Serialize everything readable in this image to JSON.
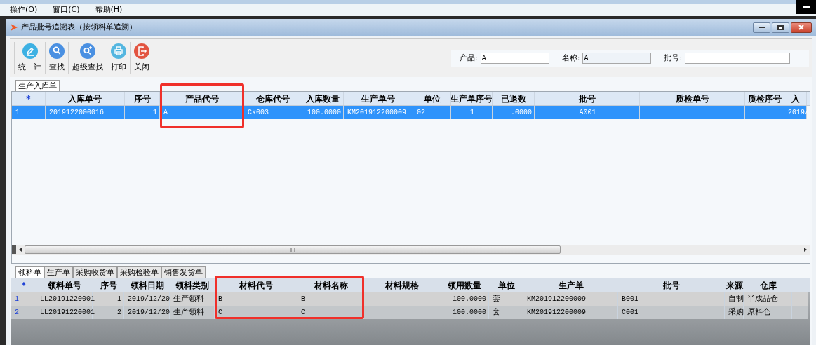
{
  "menu": [
    {
      "label": "操作(O)"
    },
    {
      "label": "窗口(C)"
    },
    {
      "label": "帮助(H)"
    }
  ],
  "window": {
    "title": "产品批号追溯表（按领料单追溯）"
  },
  "toolbar": [
    {
      "label": "统　计"
    },
    {
      "label": "查找"
    },
    {
      "label": "超级查找"
    },
    {
      "label": "打印"
    },
    {
      "label": "关闭"
    }
  ],
  "filters": [
    {
      "label": "产品:",
      "value": "A",
      "readonly": false
    },
    {
      "label": "名称:",
      "value": "A",
      "readonly": true
    },
    {
      "label": "批号:",
      "readonly": false
    }
  ],
  "top_tabs": [
    {
      "label": "生产入库单",
      "selected": true
    }
  ],
  "top_table": {
    "columns": [
      {
        "label": "*"
      },
      {
        "label": "入库单号"
      },
      {
        "label": "序号"
      },
      {
        "label": "产品代号",
        "highlighted": true
      },
      {
        "label": "仓库代号"
      },
      {
        "label": "入库数量"
      },
      {
        "label": "生产单号"
      },
      {
        "label": "单位"
      },
      {
        "label": "生产单序号"
      },
      {
        "label": "已退数"
      },
      {
        "label": "批号"
      },
      {
        "label": "质检单号"
      },
      {
        "label": "质检序号"
      },
      {
        "label": "入"
      }
    ],
    "rows": [
      {
        "selected": true,
        "cells": [
          "1",
          "2019122000016",
          "1",
          "A",
          "Ck003",
          "100.0000",
          "KM201912200009",
          "02",
          "1",
          ".0000",
          "A001",
          null,
          null,
          "2019/"
        ]
      }
    ]
  },
  "bottom_tabs": [
    {
      "label": "领料单",
      "selected": true
    },
    {
      "label": "生产单",
      "selected": false
    },
    {
      "label": "采购收货单",
      "selected": false
    },
    {
      "label": "采购检验单",
      "selected": false
    },
    {
      "label": "销售发货单",
      "selected": false
    }
  ],
  "bottom_table": {
    "columns": [
      {
        "label": "*"
      },
      {
        "label": "领料单号"
      },
      {
        "label": "序号"
      },
      {
        "label": "领料日期"
      },
      {
        "label": "领料类别"
      },
      {
        "label": "材料代号",
        "highlighted": true
      },
      {
        "label": "材料名称",
        "highlighted": true
      },
      {
        "label": "材料规格"
      },
      {
        "label": "领用数量"
      },
      {
        "label": "单位"
      },
      {
        "label": "生产单"
      },
      {
        "label": "批号"
      },
      {
        "label": "来源"
      },
      {
        "label": "仓库"
      }
    ],
    "rows": [
      {
        "selected": false,
        "cells": [
          "1",
          "LL20191220001",
          "1",
          "2019/12/20",
          "生产领料",
          "B",
          "B",
          null,
          "100.0000",
          "套",
          "KM201912200009",
          "B001",
          "自制",
          "半成品仓"
        ]
      },
      {
        "selected": false,
        "cells": [
          "2",
          "LL20191220001",
          "2",
          "2019/12/20",
          "生产领料",
          "C",
          "C",
          null,
          "100.0000",
          "套",
          "KM201912200009",
          "C001",
          "采购",
          "原料仓"
        ]
      }
    ]
  }
}
